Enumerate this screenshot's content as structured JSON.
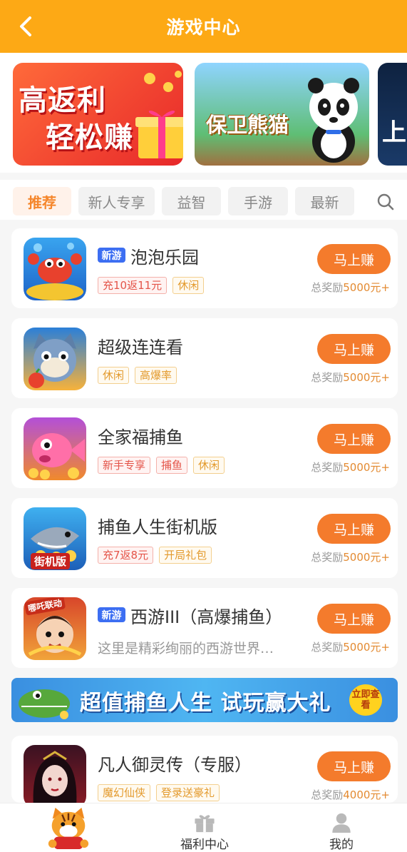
{
  "header": {
    "title": "游戏中心",
    "back_icon": "chevron-left-icon"
  },
  "banners": [
    {
      "line1": "高返利",
      "line2": "轻松赚",
      "color": "#e7282a"
    },
    {
      "text": "保卫熊猫"
    },
    {
      "text": "上"
    }
  ],
  "tabs": [
    "推荐",
    "新人专享",
    "益智",
    "手游",
    "最新"
  ],
  "active_tab": "推荐",
  "games": [
    {
      "badge": "新游",
      "name": "泡泡乐园",
      "tags": [
        {
          "text": "充10返11元",
          "style": "red"
        },
        {
          "text": "休闲",
          "style": "orange"
        }
      ],
      "button": "马上赚",
      "reward_prefix": "总奖励",
      "reward": "5000元+"
    },
    {
      "badge": "",
      "name": "超级连连看",
      "tags": [
        {
          "text": "休闲",
          "style": "orange"
        },
        {
          "text": "高爆率",
          "style": "orange"
        }
      ],
      "button": "马上赚",
      "reward_prefix": "总奖励",
      "reward": "5000元+"
    },
    {
      "badge": "",
      "name": "全家福捕鱼",
      "tags": [
        {
          "text": "新手专享",
          "style": "red"
        },
        {
          "text": "捕鱼",
          "style": "red"
        },
        {
          "text": "休闲",
          "style": "orange"
        }
      ],
      "button": "马上赚",
      "reward_prefix": "总奖励",
      "reward": "5000元+"
    },
    {
      "badge": "",
      "name": "捕鱼人生街机版",
      "icon_text": "街机版",
      "tags": [
        {
          "text": "充7返8元",
          "style": "red"
        },
        {
          "text": "开局礼包",
          "style": "orange"
        }
      ],
      "button": "马上赚",
      "reward_prefix": "总奖励",
      "reward": "5000元+"
    },
    {
      "badge": "新游",
      "name": "西游III（高爆捕鱼）",
      "icon_text": "哪吒联动",
      "desc": "这里是精彩绚丽的西游世界…",
      "button": "马上赚",
      "reward_prefix": "总奖励",
      "reward": "5000元+"
    },
    {
      "badge": "",
      "name": "凡人御灵传（专服）",
      "tags": [
        {
          "text": "魔幻仙侠",
          "style": "orange"
        },
        {
          "text": "登录送豪礼",
          "style": "orange"
        }
      ],
      "button": "马上赚",
      "reward_prefix": "总奖励",
      "reward": "4000元+"
    }
  ],
  "promo": {
    "text": "超值捕鱼人生 试玩赢大礼",
    "seal": "立即查看"
  },
  "nav": [
    {
      "label": "",
      "icon": "tiger-mascot-icon"
    },
    {
      "label": "福利中心",
      "icon": "gift-icon"
    },
    {
      "label": "我的",
      "icon": "user-icon"
    }
  ],
  "colors": {
    "header": "#fda915",
    "accent": "#f47b2c",
    "badge": "#3c6ef2"
  }
}
